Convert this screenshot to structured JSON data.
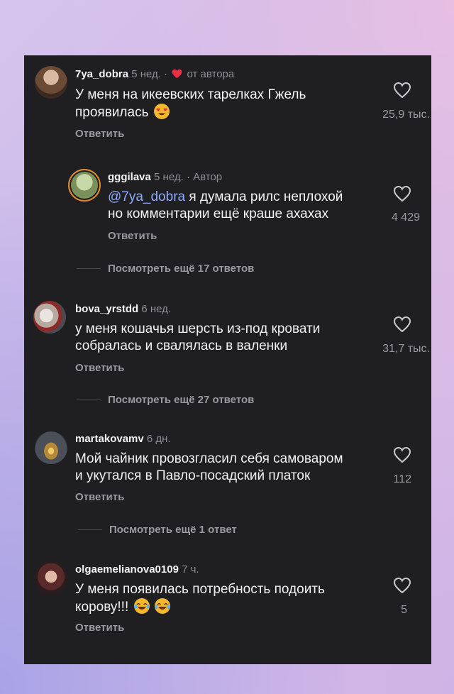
{
  "comments": [
    {
      "username": "7ya_dobra",
      "time": "5 нед.",
      "sep": "·",
      "author_tag": "от автора",
      "line1": "У меня на икеевских тарелках Гжель",
      "line2": "проявилась",
      "emoji": "heart-eyes-emoji",
      "likes": "25,9 тыс.",
      "reply": "Ответить"
    },
    {
      "username": "gggilava",
      "time": "5 нед.",
      "sep": "·",
      "author_tag": "Автор",
      "mention": "@7ya_dobra",
      "line1": "я думала рилс неплохой",
      "line2": "но комментарии ещё краше ахахах",
      "likes": "4 429",
      "reply": "Ответить",
      "more_replies": "Посмотреть ещё 17 ответов"
    },
    {
      "username": "bova_yrstdd",
      "time": "6 нед.",
      "line1": "у меня кошачья шерсть из-под кровати",
      "line2": "собралась и свалялась в валенки",
      "likes": "31,7 тыс.",
      "reply": "Ответить",
      "more_replies": "Посмотреть ещё 27 ответов"
    },
    {
      "username": "martakovamv",
      "time": "6 дн.",
      "line1": "Мой чайник провозгласил себя самоваром",
      "line2": "и укутался в Павло-посадский платок",
      "likes": "112",
      "reply": "Ответить",
      "more_replies": "Посмотреть ещё 1 ответ"
    },
    {
      "username": "olgaemelianova0109",
      "time": "7 ч.",
      "line1": "У меня появилась потребность подоить",
      "line2": "корову!!!",
      "emoji": "laughing-tears-emoji",
      "likes": "5",
      "reply": "Ответить"
    }
  ],
  "colors": {
    "panel": "#1f1f22",
    "text": "#f2f2f2",
    "secondary": "#8e8e93",
    "mention": "#8fa9ff",
    "heart_red": "#ed2f45"
  }
}
